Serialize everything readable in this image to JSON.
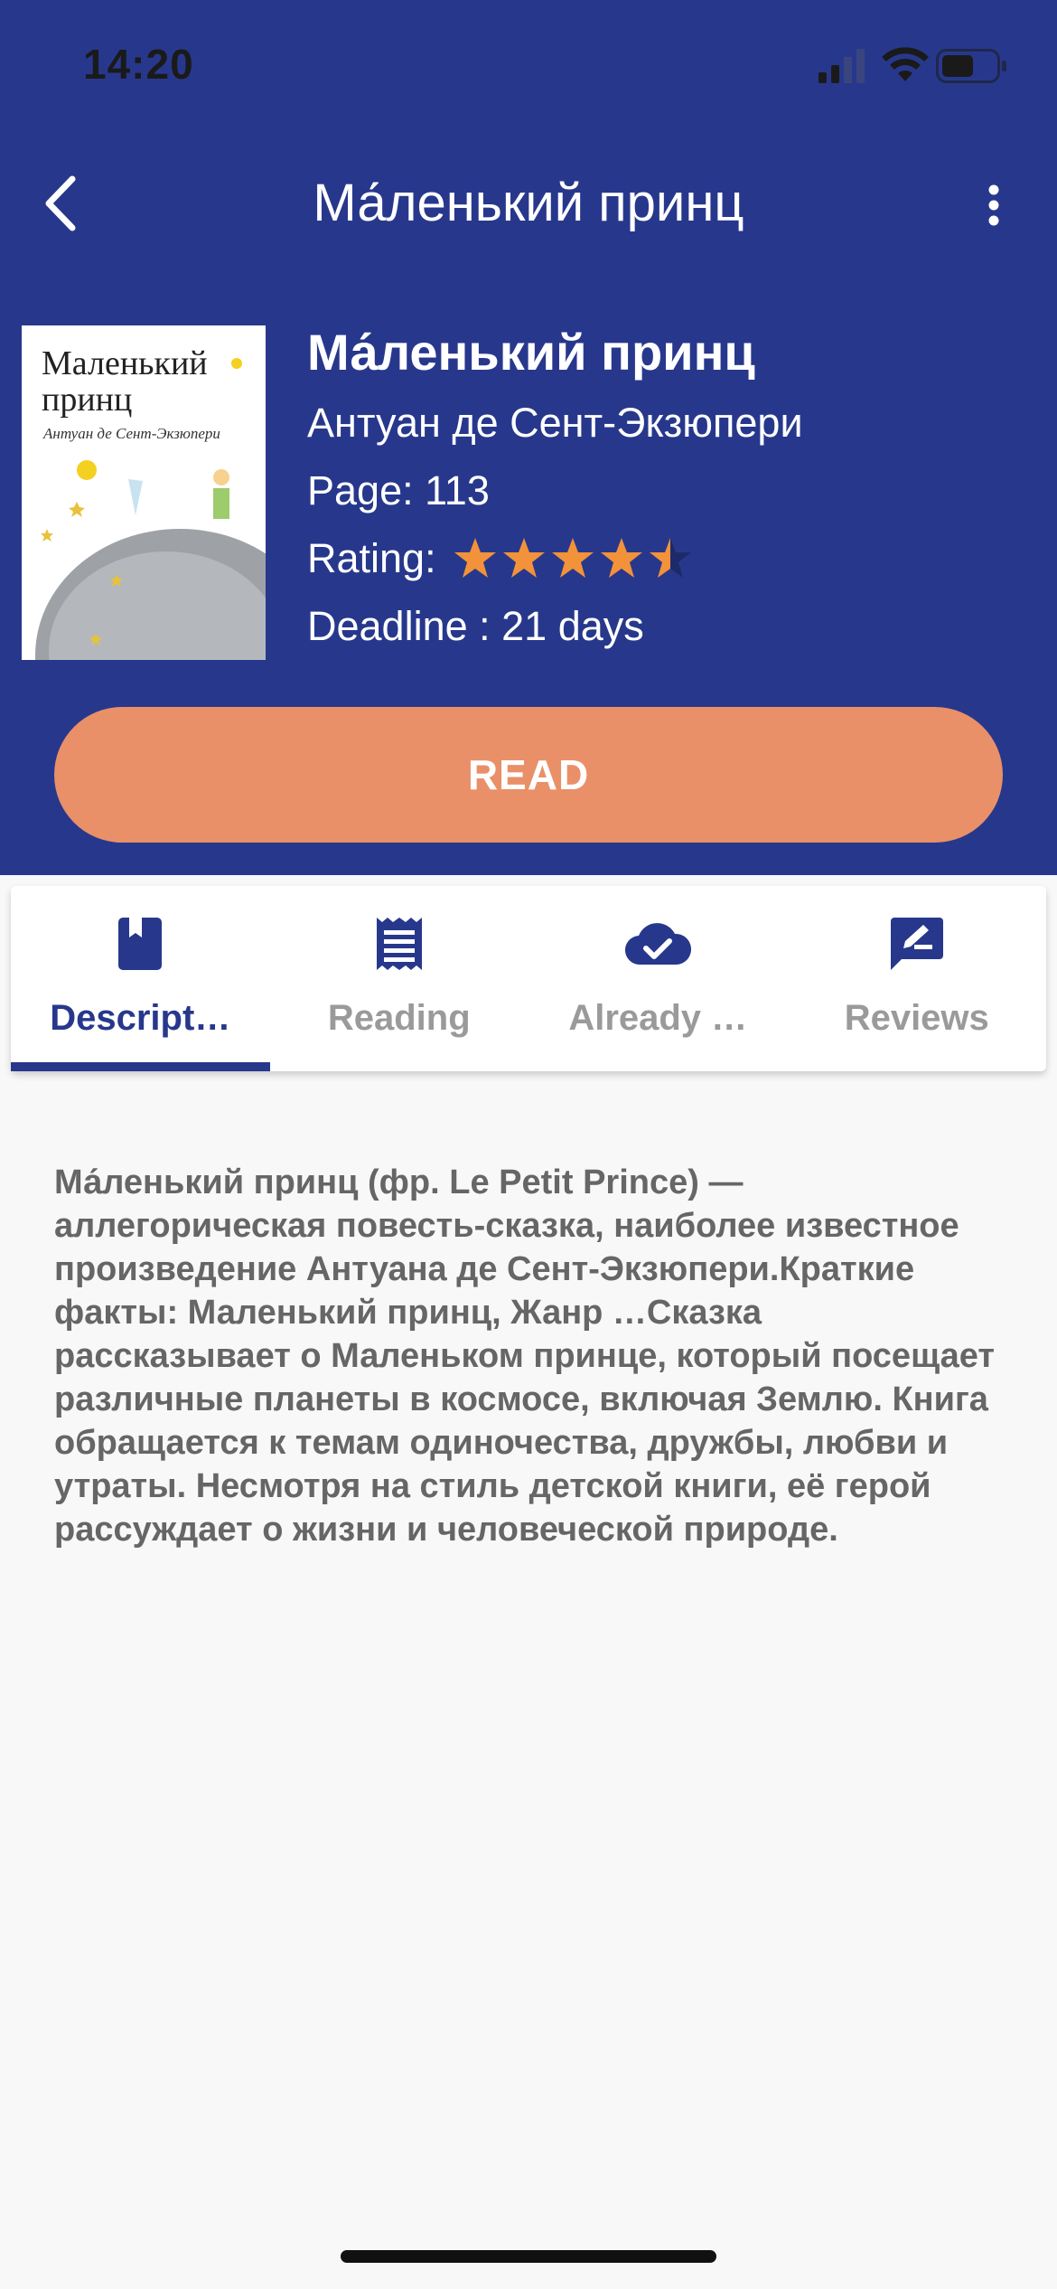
{
  "status_bar": {
    "time": "14:20"
  },
  "nav": {
    "title": "Ма́ленький принц",
    "back_icon": "chevron-left-icon",
    "more_icon": "more-vertical-icon"
  },
  "book": {
    "cover": {
      "title": "Маленький принц",
      "author": "Антуан де Сент-Экзюпери"
    },
    "title": "Ма́ленький принц",
    "author": "Антуан де Сент-Экзюпери",
    "pages_label": "Page: 113",
    "rating_label": "Rating:",
    "rating_value": 4.5,
    "rating_max": 5,
    "deadline_label": "Deadline : 21 days"
  },
  "read_button": {
    "label": "READ"
  },
  "tabs": [
    {
      "label": "Descript…",
      "icon": "book-icon",
      "active": true
    },
    {
      "label": "Reading",
      "icon": "receipt-icon",
      "active": false
    },
    {
      "label": "Already …",
      "icon": "cloud-check-icon",
      "active": false
    },
    {
      "label": "Reviews",
      "icon": "edit-note-icon",
      "active": false
    }
  ],
  "description": {
    "text": "Ма́ленький принц (фр. Le Petit Prince) — аллегорическая повесть-сказка, наиболее известное произведение Антуана де Сент-Экзюпери.Краткие факты: Маленький принц, Жанр …Сказка рассказывает о Маленьком принце, который посещает различные планеты в космосе, включая Землю. Книга обращается к темам одиночества, дружбы, любви и утраты. Несмотря на стиль детской книги, её герой рассуждает о жизни и человеческой природе."
  },
  "colors": {
    "header_bg": "#27388c",
    "accent": "#e99069",
    "star": "#f2923a",
    "tab_active": "#27388c",
    "tab_inactive": "#9a9a9a",
    "body_bg": "#f8f8f8"
  }
}
